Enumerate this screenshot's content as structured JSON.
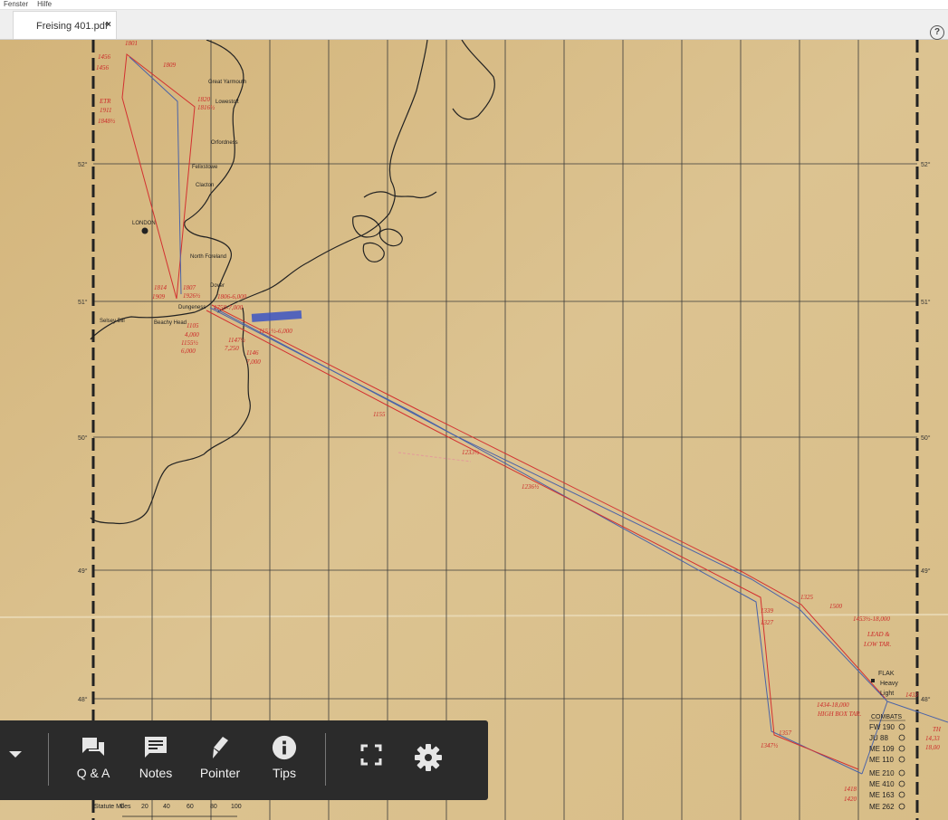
{
  "menubar": {
    "items": [
      "Fenster",
      "Hilfe"
    ]
  },
  "tab": {
    "title": "Freising 401.pdf",
    "close": "×"
  },
  "help": {
    "label": "?"
  },
  "map": {
    "place_labels": [
      "Great Yarmouth",
      "Lowestoft",
      "Orfordness",
      "Felixstowe",
      "Clacton",
      "LONDON",
      "North Foreland",
      "Dover",
      "Dungeness",
      "Selsey Bill",
      "Beachy Head"
    ],
    "lat_labels": [
      "52°",
      "51°",
      "50°",
      "49°",
      "48°"
    ],
    "times": [
      "1801",
      "1456",
      "1456",
      "1809",
      "1820",
      "1816½",
      "ETR",
      "1911",
      "1848½",
      "1814",
      "1909",
      "1807",
      "1926½",
      "1806-6,000",
      "1758-7,000",
      "1105",
      "4,000",
      "1155½",
      "6,000",
      "1147½",
      "7,250",
      "1146",
      "7,000",
      "1151½-6,000",
      "1155",
      "1233½",
      "1236½",
      "1325",
      "1500",
      "1339",
      "1327",
      "1453½-18,000",
      "LEAD &",
      "LOW TAR.",
      "1434-18,000",
      "HIGH BOX TAR.",
      "1357",
      "1347½",
      "1418",
      "1420",
      "1433",
      "TH",
      "14,33",
      "18,00"
    ],
    "flak_legend": {
      "title": "FLAK",
      "heavy": "Heavy",
      "light": "Light"
    },
    "combats": {
      "title": "COMBATS",
      "rows": [
        "FW 190",
        "JU 88",
        "ME 109",
        "ME 110",
        "ME 210",
        "ME 410",
        "ME 163",
        "ME 262"
      ]
    },
    "scale": {
      "label": "Statute Miles",
      "ticks": [
        "0",
        "20",
        "40",
        "60",
        "80",
        "100"
      ]
    }
  },
  "toolbar": {
    "qa_label": "Q & A",
    "notes_label": "Notes",
    "pointer_label": "Pointer",
    "tips_label": "Tips"
  },
  "colors": {
    "map_bg": "#d9c08c",
    "toolbar_bg": "#2b2b2b",
    "route_red": "#d33030",
    "route_blue": "#4a63a8"
  }
}
